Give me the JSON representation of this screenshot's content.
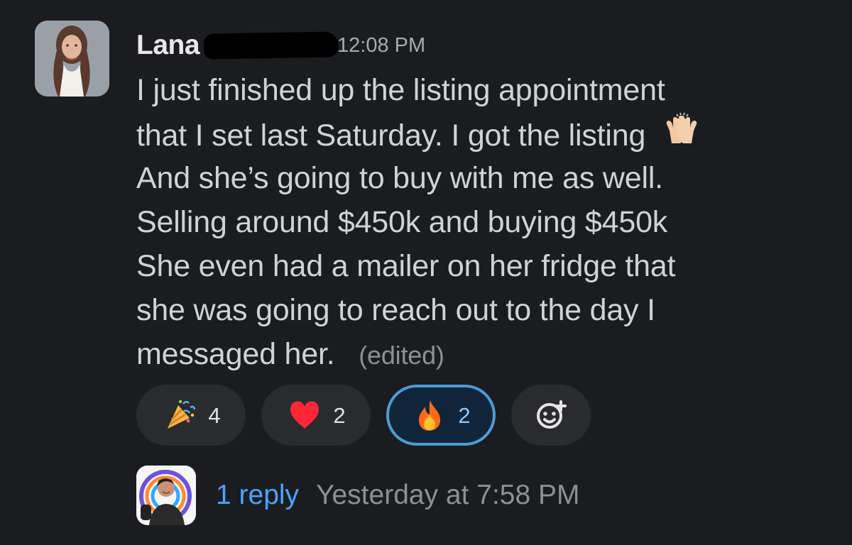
{
  "message": {
    "author": "Lana",
    "timestamp": "12:08 PM",
    "lines": [
      "I just finished up the listing appointment",
      "that I set last Saturday. I got the listing",
      "And she’s going to buy with me as well.",
      "Selling around $450k and buying $450k",
      "She even had a mailer on her fridge that",
      "she was going to reach out to the day I",
      "messaged her."
    ],
    "edited_label": "(edited)",
    "inline_emoji": "raised-hands-icon"
  },
  "reactions": [
    {
      "icon": "party-popper-icon",
      "count": "4",
      "active": false
    },
    {
      "icon": "heart-icon",
      "count": "2",
      "active": false
    },
    {
      "icon": "fire-icon",
      "count": "2",
      "active": true
    }
  ],
  "add_reaction": {
    "icon": "add-reaction-icon"
  },
  "thread": {
    "reply_label": "1 reply",
    "reply_time": "Yesterday at 7:58 PM"
  },
  "colors": {
    "background": "#1b1c1f",
    "text": "#d1d2d3",
    "muted": "#8e8f92",
    "link": "#4aa3ff",
    "active_border": "#4d9bd4"
  }
}
